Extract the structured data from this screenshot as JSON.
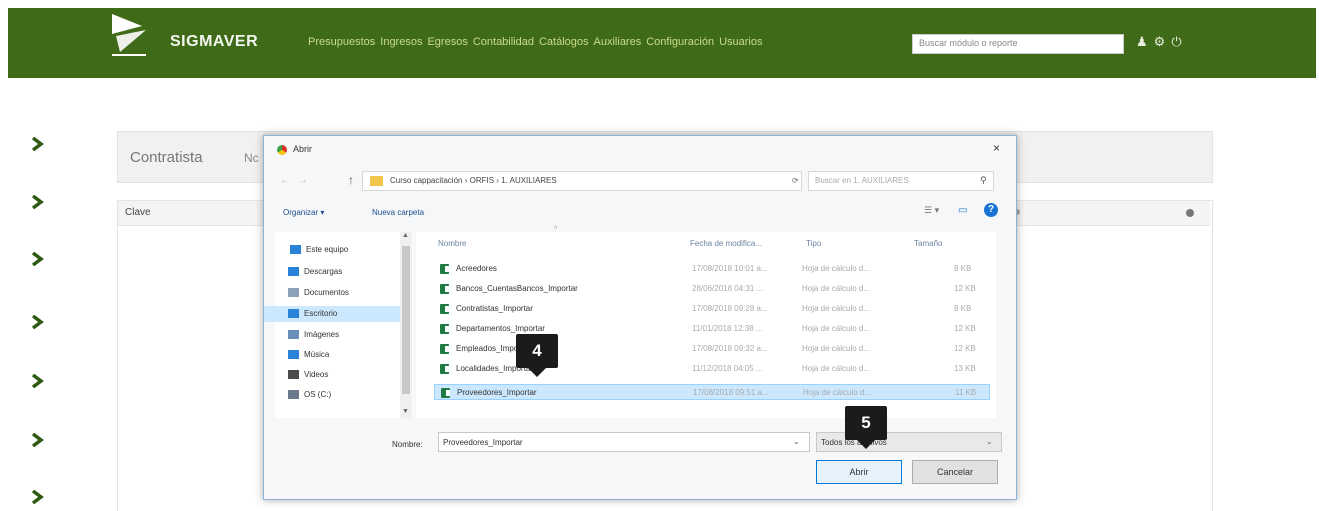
{
  "app": {
    "brand": "SIGMAVER",
    "nav": [
      "Presupuestos",
      "Ingresos",
      "Egresos",
      "Contabilidad",
      "Catálogos",
      "Auxiliares",
      "Configuración",
      "Usuarios"
    ],
    "search_placeholder": "Buscar módulo o reporte",
    "header_color": "#3f6b19"
  },
  "page": {
    "panel_title": "Contratista",
    "panel_title_suffix": "Nc",
    "grid_header": "Clave"
  },
  "dialog": {
    "title": "Abrir",
    "close": "×",
    "address": "Curso cappacitación  ›  ORFIS  ›  1. AUXILIARES",
    "search_placeholder": "Buscar en 1. AUXILIARES",
    "organize": "Organizar ▾",
    "new_folder": "Nueva carpeta",
    "tree": [
      {
        "label": "Este equipo",
        "icon": "computer-icon"
      },
      {
        "label": "Descargas",
        "icon": "download-icon"
      },
      {
        "label": "Documentos",
        "icon": "documents-icon"
      },
      {
        "label": "Escritorio",
        "icon": "desktop-icon"
      },
      {
        "label": "Imágenes",
        "icon": "pictures-icon"
      },
      {
        "label": "Música",
        "icon": "music-icon"
      },
      {
        "label": "Videos",
        "icon": "videos-icon"
      },
      {
        "label": "OS (C:)",
        "icon": "drive-icon"
      }
    ],
    "columns": {
      "name": "Nombre",
      "date": "Fecha de modifica...",
      "type": "Tipo",
      "size": "Tamaño"
    },
    "files": [
      {
        "name": "Acreedores",
        "date": "17/08/2018 10:01 a...",
        "type": "Hoja de cálculo d...",
        "size": "8 KB"
      },
      {
        "name": "Bancos_CuentasBancos_Importar",
        "date": "28/06/2018 04:31 ...",
        "type": "Hoja de cálculo d...",
        "size": "12 KB"
      },
      {
        "name": "Contratistas_Importar",
        "date": "17/08/2018 09:28 a...",
        "type": "Hoja de cálculo d...",
        "size": "8 KB"
      },
      {
        "name": "Departamentos_Importar",
        "date": "11/01/2018 12:38 ...",
        "type": "Hoja de cálculo d...",
        "size": "12 KB"
      },
      {
        "name": "Empleados_Importar",
        "date": "17/08/2018 09:32 a...",
        "type": "Hoja de cálculo d...",
        "size": "12 KB"
      },
      {
        "name": "Localidades_Importar",
        "date": "11/12/2018 04:05 ...",
        "type": "Hoja de cálculo d...",
        "size": "13 KB"
      },
      {
        "name": "Proveedores_Importar",
        "date": "17/08/2018 09:51 a...",
        "type": "Hoja de cálculo d...",
        "size": "11 KB"
      }
    ],
    "selected_index": 6,
    "filename_label": "Nombre:",
    "filename_value": "Proveedores_Importar",
    "filetype": "Todos los archivos",
    "open": "Abrir",
    "cancel": "Cancelar"
  },
  "callouts": {
    "step4": "4",
    "step5": "5"
  }
}
